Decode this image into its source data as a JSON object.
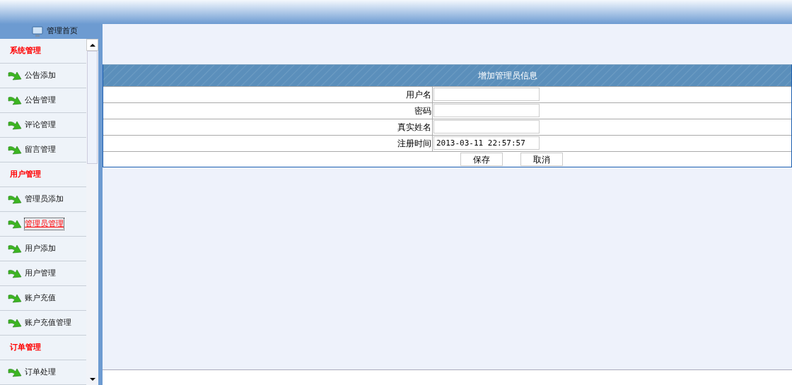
{
  "sidebar": {
    "home_link": "管理首页",
    "items": [
      {
        "kind": "section",
        "label": "系统管理"
      },
      {
        "kind": "link",
        "label": "公告添加",
        "selected": false
      },
      {
        "kind": "link",
        "label": "公告管理",
        "selected": false
      },
      {
        "kind": "link",
        "label": "评论管理",
        "selected": false
      },
      {
        "kind": "link",
        "label": "留言管理",
        "selected": false
      },
      {
        "kind": "section",
        "label": "用户管理"
      },
      {
        "kind": "link",
        "label": "管理员添加",
        "selected": false
      },
      {
        "kind": "link",
        "label": "管理员管理",
        "selected": true
      },
      {
        "kind": "link",
        "label": "用户添加",
        "selected": false
      },
      {
        "kind": "link",
        "label": "用户管理",
        "selected": false
      },
      {
        "kind": "link",
        "label": "账户充值",
        "selected": false
      },
      {
        "kind": "link",
        "label": "账户充值管理",
        "selected": false
      },
      {
        "kind": "section",
        "label": "订单管理"
      },
      {
        "kind": "link",
        "label": "订单处理",
        "selected": false
      }
    ]
  },
  "form": {
    "title": "增加管理员信息",
    "fields": [
      {
        "label": "用户名"
      },
      {
        "label": "密码"
      },
      {
        "label": "真实姓名"
      },
      {
        "label": "注册时间",
        "value": "2013-03-11 22:57:57"
      }
    ],
    "buttons": [
      "保存",
      "取消"
    ]
  }
}
